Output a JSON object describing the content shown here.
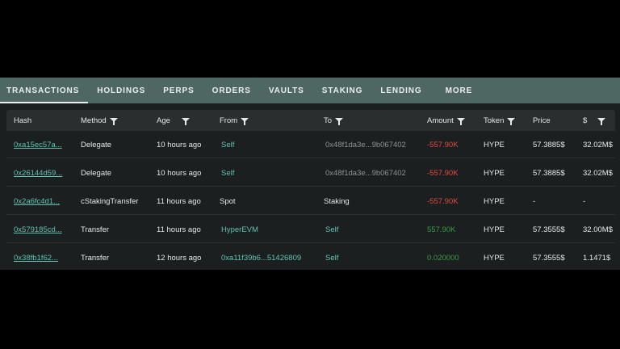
{
  "tabs": [
    "TRANSACTIONS",
    "HOLDINGS",
    "PERPS",
    "ORDERS",
    "VAULTS",
    "STAKING",
    "LENDING",
    "MORE"
  ],
  "active_tab": "TRANSACTIONS",
  "columns": {
    "hash": "Hash",
    "method": "Method",
    "age": "Age",
    "from": "From",
    "to": "To",
    "amount": "Amount",
    "token": "Token",
    "price": "Price",
    "usd": "$"
  },
  "rows": [
    {
      "hash": "0xa15ec57a...",
      "method": "Delegate",
      "age": "10 hours ago",
      "from": "Self",
      "to": "0x48f1da3e...9b067402",
      "amount": "-557.90K",
      "token": "HYPE",
      "price": "57.3885$",
      "usd": "32.02M$"
    },
    {
      "hash": "0x26144d59...",
      "method": "Delegate",
      "age": "10 hours ago",
      "from": "Self",
      "to": "0x48f1da3e...9b067402",
      "amount": "-557.90K",
      "token": "HYPE",
      "price": "57.3885$",
      "usd": "32.02M$"
    },
    {
      "hash": "0x2a6fc4d1...",
      "method": "cStakingTransfer",
      "age": "11 hours ago",
      "from": "Spot",
      "to": "Staking",
      "amount": "-557.90K",
      "token": "HYPE",
      "price": "-",
      "usd": "-"
    },
    {
      "hash": "0x579185cd...",
      "method": "Transfer",
      "age": "11 hours ago",
      "from": "HyperEVM",
      "to": "Self",
      "amount": "557.90K",
      "token": "HYPE",
      "price": "57.3555$",
      "usd": "32.00M$"
    },
    {
      "hash": "0x38fb1f62...",
      "method": "Transfer",
      "age": "12 hours ago",
      "from": "0xa11f39b6...51426809",
      "to": "Self",
      "amount": "0.020000",
      "token": "HYPE",
      "price": "57.3555$",
      "usd": "1.1471$"
    }
  ],
  "colors": {
    "accent": "#5fc4b5",
    "negative": "#e04a3f",
    "positive": "#3a9a48",
    "tabbar": "#4e6763"
  }
}
